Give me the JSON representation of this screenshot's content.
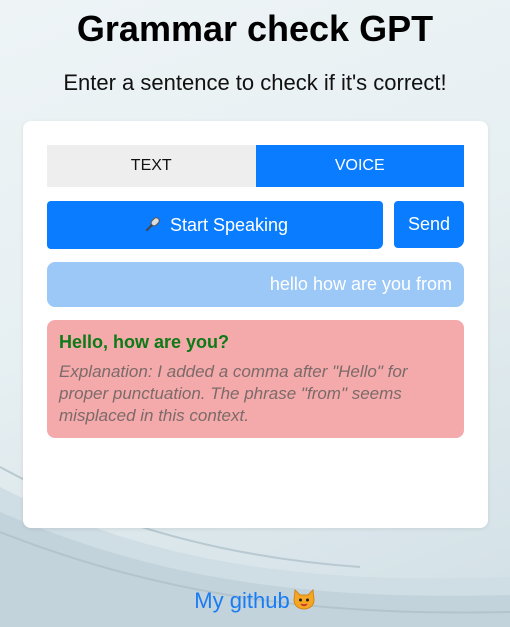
{
  "header": {
    "title": "Grammar check GPT",
    "subtitle": "Enter a sentence to check if it's correct!"
  },
  "tabs": [
    {
      "label": "TEXT",
      "active": false
    },
    {
      "label": "VOICE",
      "active": true
    }
  ],
  "controls": {
    "speak_label": "Start Speaking",
    "speak_icon": "microphone-icon",
    "send_label": "Send"
  },
  "conversation": {
    "user_message": "hello how are you from",
    "corrected": "Hello, how are you?",
    "explanation": "Explanation: I added a comma after \"Hello\" for proper punctuation. The phrase \"from\" seems misplaced in this context."
  },
  "footer": {
    "link_label": "My github",
    "link_icon": "cat-face-icon"
  },
  "colors": {
    "accent": "#0a7cff",
    "user_bubble": "#9cc8f7",
    "result_bg": "#f4aaaa",
    "corrected_text": "#0c7a17",
    "link": "#1a7cf5"
  }
}
